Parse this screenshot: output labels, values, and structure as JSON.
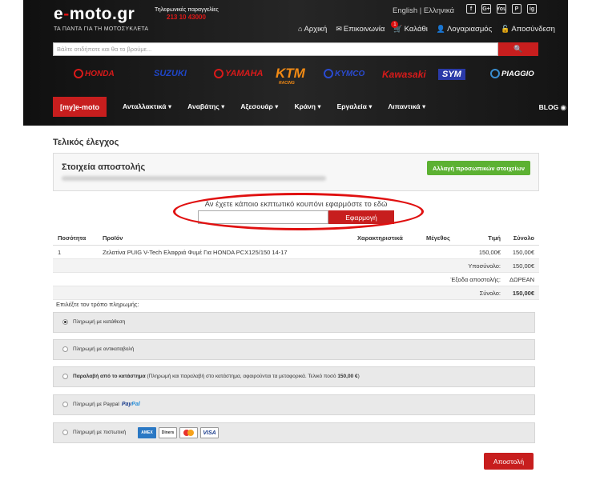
{
  "header": {
    "logo_main": "e",
    "logo_dash": "-",
    "logo_rest": "moto.gr",
    "tagline": "ΤΑ ΠΑΝΤΑ ΓΙΑ ΤΗ ΜΟΤΟΣΥΚΛΕΤΑ",
    "phone_label": "Τηλεφωνικές παραγγελίες",
    "phone_number": "213 10 43000",
    "language": "English | Ελληνικά",
    "social": [
      "f",
      "G+",
      "You",
      "P",
      "ig"
    ],
    "nav": [
      {
        "icon": "⌂",
        "label": "Αρχική"
      },
      {
        "icon": "✉",
        "label": "Επικοινωνία"
      },
      {
        "icon": "🛒",
        "label": "Καλάθι",
        "badge": "1"
      },
      {
        "icon": "👤",
        "label": "Λογαριασμός"
      },
      {
        "icon": "🔓",
        "label": "Αποσύνδεση"
      }
    ],
    "search_placeholder": "Βάλτε οτιδήποτε και θα το βρούμε...",
    "search_icon": "🔍",
    "brands": [
      "HONDA",
      "SUZUKI",
      "YAMAHA",
      "KTM",
      "KYMCO",
      "Kawasaki",
      "SYM",
      "PIAGGIO"
    ],
    "brand_sub_ktm": "RACING",
    "menu": [
      "[my]e-moto",
      "Ανταλλακτικά",
      "Αναβάτης",
      "Αξεσουάρ",
      "Κράνη",
      "Εργαλεία",
      "Λιπαντικά"
    ],
    "blog": "BLOG"
  },
  "checkout": {
    "title": "Τελικός έλεγχος",
    "shipping_title": "Στοιχεία αποστολής",
    "change_button": "Αλλαγή προσωπικών στοιχείων",
    "coupon_label": "Αν έχετε κάποιο εκπτωτικό κουπόνι εφαρμόστε το εδώ",
    "coupon_button": "Εφαρμογή"
  },
  "order": {
    "columns": [
      "Ποσότητα",
      "Προϊόν",
      "Χαρακτηριστικά",
      "Μέγεθος",
      "Τιμή",
      "Σύνολο"
    ],
    "items": [
      {
        "qty": "1",
        "product": "Ζελατίνα PUIG V-Tech Ελαφριά Φυμέ Για HONDA PCX125/150 14-17",
        "features": "",
        "size": "",
        "price": "150,00€",
        "total": "150,00€"
      }
    ],
    "subtotal_label": "Υποσύνολο:",
    "subtotal": "150,00€",
    "shipping_label": "Έξοδα αποστολής:",
    "shipping": "ΔΩΡΕΑΝ",
    "total_label": "Σύνολο:",
    "total": "150,00€"
  },
  "payment": {
    "label": "Επιλέξτε τον τρόπο πληρωμής:",
    "options": [
      {
        "text": "Πληρωμή με κατάθεση"
      },
      {
        "text": "Πληρωμή με αντικαταβολή"
      },
      {
        "text_bold": "Παραλαβή από το κατάστημα",
        "text": " (Πληρωμή και παραλαβή στο κατάστημα, αφαιρούνται τα μεταφορικά. Τελικό ποσό ",
        "amount": "150,00 €",
        "tail": ")"
      },
      {
        "text": "Πληρωμή με Paypal",
        "logo_a": "Pay",
        "logo_b": "Pal"
      },
      {
        "text": "Πληρωμή με πιστωτική",
        "cards": [
          "AMEX",
          "Diners",
          "",
          "VISA"
        ]
      }
    ],
    "submit": "Αποστολή"
  }
}
